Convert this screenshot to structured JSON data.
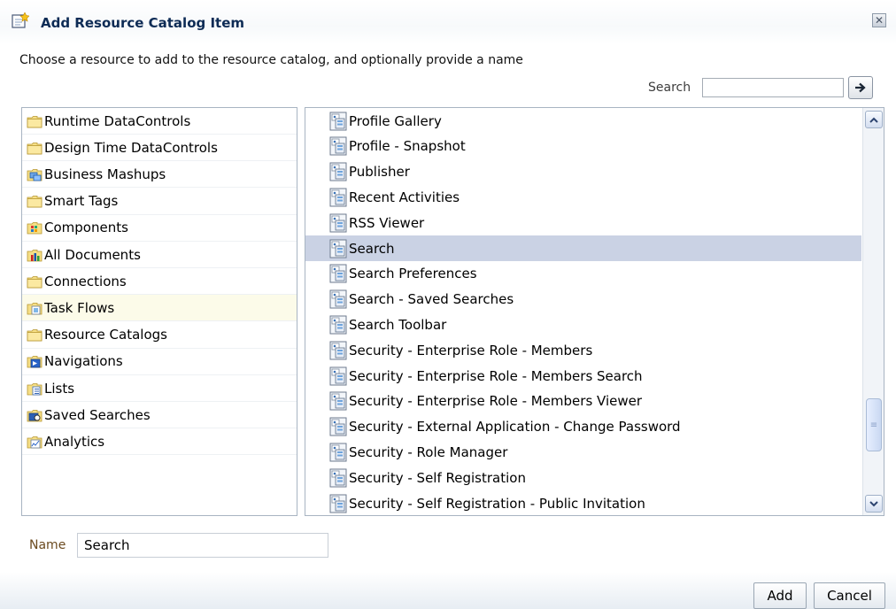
{
  "dialog": {
    "title": "Add Resource Catalog Item",
    "instruction": "Choose a resource to add to the resource catalog, and optionally provide a name"
  },
  "search": {
    "label": "Search",
    "value": ""
  },
  "categories": [
    {
      "label": "Runtime DataControls",
      "icon": "folder-icon"
    },
    {
      "label": "Design Time DataControls",
      "icon": "folder-icon"
    },
    {
      "label": "Business Mashups",
      "icon": "mashup-icon"
    },
    {
      "label": "Smart Tags",
      "icon": "folder-icon"
    },
    {
      "label": "Components",
      "icon": "components-icon"
    },
    {
      "label": "All Documents",
      "icon": "documents-icon"
    },
    {
      "label": "Connections",
      "icon": "folder-icon"
    },
    {
      "label": "Task Flows",
      "icon": "task-flow-icon"
    },
    {
      "label": "Resource Catalogs",
      "icon": "folder-icon"
    },
    {
      "label": "Navigations",
      "icon": "navigation-icon"
    },
    {
      "label": "Lists",
      "icon": "list-icon"
    },
    {
      "label": "Saved Searches",
      "icon": "saved-search-icon"
    },
    {
      "label": "Analytics",
      "icon": "analytics-icon"
    }
  ],
  "active_category": "Task Flows",
  "items": [
    "Profile Gallery",
    "Profile - Snapshot",
    "Publisher",
    "Recent Activities",
    "RSS Viewer",
    "Search",
    "Search Preferences",
    "Search - Saved Searches",
    "Search Toolbar",
    "Security - Enterprise Role - Members",
    "Security - Enterprise Role - Members Search",
    "Security - Enterprise Role - Members Viewer",
    "Security - External Application - Change Password",
    "Security - Role Manager",
    "Security - Self Registration",
    "Security - Self Registration - Public Invitation"
  ],
  "selected_item": "Search",
  "name_field": {
    "label": "Name",
    "value": "Search"
  },
  "buttons": {
    "add": "Add",
    "cancel": "Cancel"
  },
  "colors": {
    "title": "#0d2b55",
    "selected_row": "#cad2e4",
    "active_category": "#fcfbe9",
    "name_label": "#6b4a1f"
  }
}
